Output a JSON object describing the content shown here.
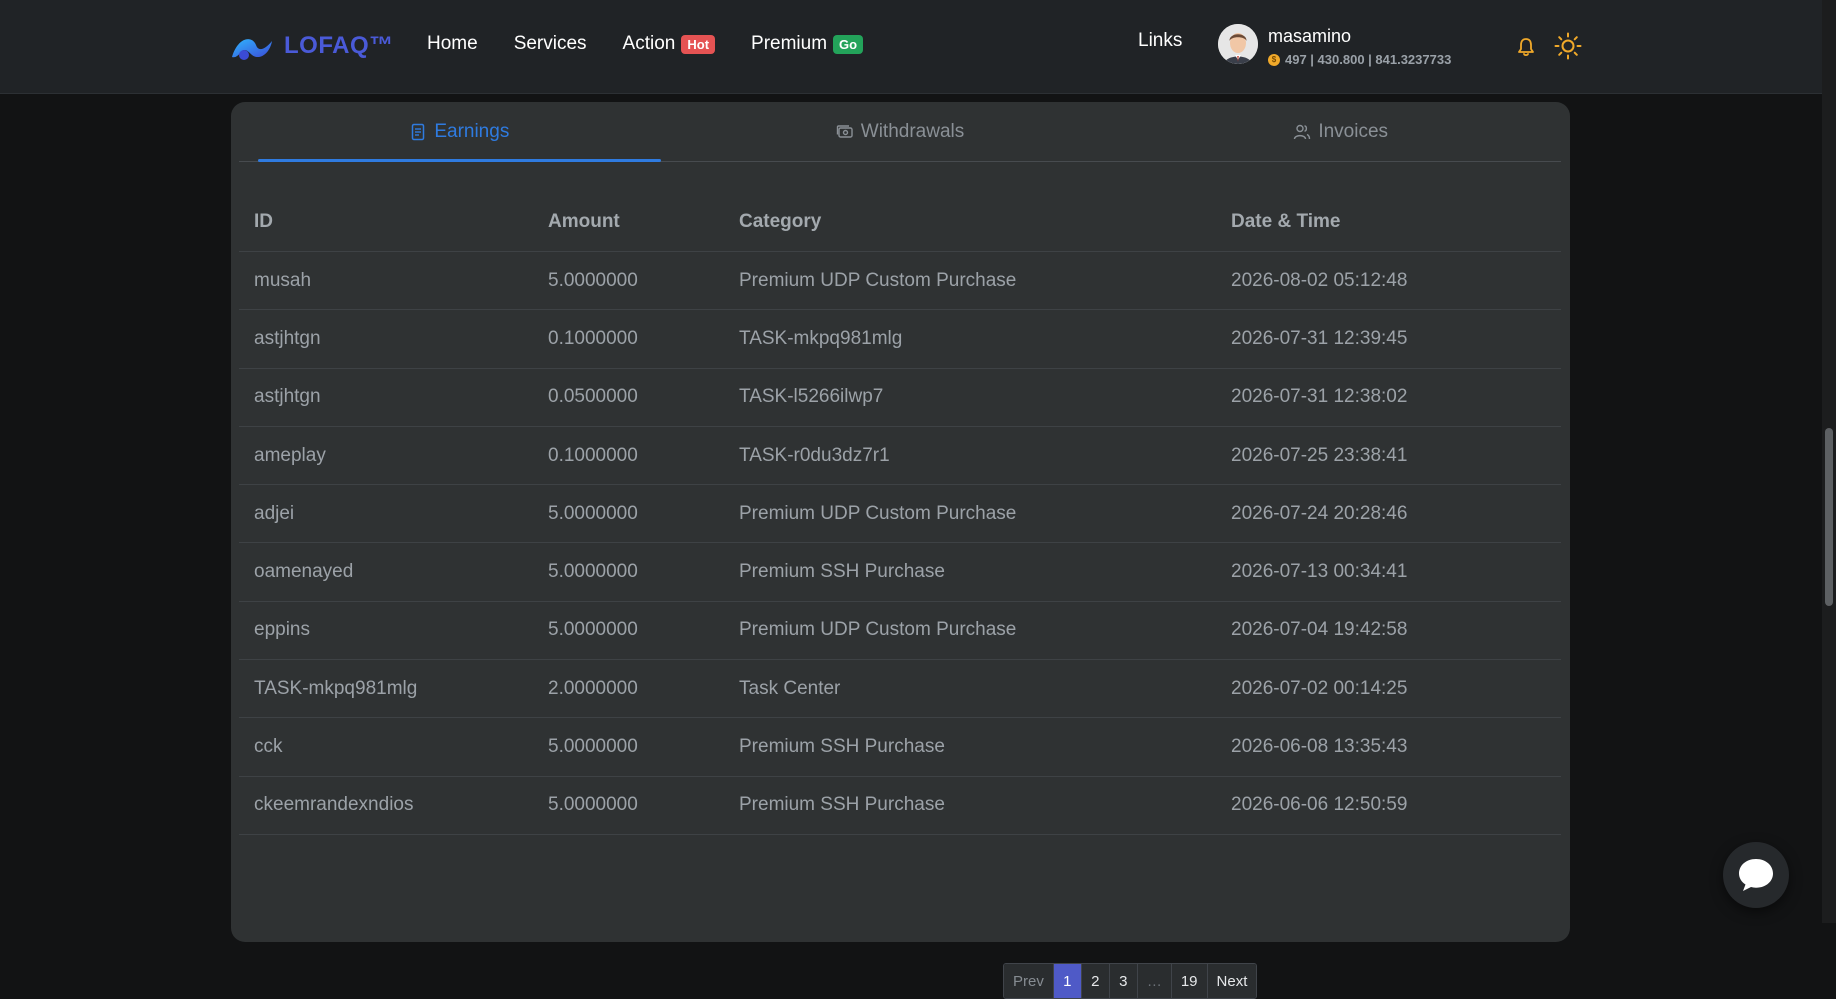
{
  "brand": {
    "name": "LOFAQ™",
    "icon": "wave-logo-icon"
  },
  "nav": {
    "items": [
      {
        "label": "Home"
      },
      {
        "label": "Services"
      },
      {
        "label": "Action",
        "badge": "Hot",
        "badge_color": "#e55353"
      },
      {
        "label": "Premium",
        "badge": "Go",
        "badge_color": "#23a35a"
      }
    ],
    "links_label": "Links"
  },
  "user": {
    "name": "masamino",
    "stats": "497 | 430.800 | 841.3237733"
  },
  "icons": {
    "notifications": "bell-icon",
    "theme": "sun-icon",
    "chat": "chat-bubble-icon"
  },
  "tabs": [
    {
      "label": "Earnings",
      "icon": "document-icon",
      "active": true
    },
    {
      "label": "Withdrawals",
      "icon": "money-icon",
      "active": false
    },
    {
      "label": "Invoices",
      "icon": "users-icon",
      "active": false
    }
  ],
  "table": {
    "headers": [
      "ID",
      "Amount",
      "Category",
      "Date & Time"
    ],
    "rows": [
      [
        "musah",
        "5.0000000",
        "Premium UDP Custom Purchase",
        "2026-08-02 05:12:48"
      ],
      [
        "astjhtgn",
        "0.1000000",
        "TASK-mkpq981mlg",
        "2026-07-31 12:39:45"
      ],
      [
        "astjhtgn",
        "0.0500000",
        "TASK-l5266ilwp7",
        "2026-07-31 12:38:02"
      ],
      [
        "ameplay",
        "0.1000000",
        "TASK-r0du3dz7r1",
        "2026-07-25 23:38:41"
      ],
      [
        "adjei",
        "5.0000000",
        "Premium UDP Custom Purchase",
        "2026-07-24 20:28:46"
      ],
      [
        "oamenayed",
        "5.0000000",
        "Premium SSH Purchase",
        "2026-07-13 00:34:41"
      ],
      [
        "eppins",
        "5.0000000",
        "Premium UDP Custom Purchase",
        "2026-07-04 19:42:58"
      ],
      [
        "TASK-mkpq981mlg",
        "2.0000000",
        "Task Center",
        "2026-07-02 00:14:25"
      ],
      [
        "cck",
        "5.0000000",
        "Premium SSH Purchase",
        "2026-06-08 13:35:43"
      ],
      [
        "ckeemrandexndios",
        "5.0000000",
        "Premium SSH Purchase",
        "2026-06-06 12:50:59"
      ]
    ]
  },
  "pagination": {
    "prev": "Prev",
    "pages": [
      "1",
      "2",
      "3",
      "…",
      "19"
    ],
    "current": "1",
    "next": "Next"
  },
  "colors": {
    "accent": "#2f7be0",
    "brand": "#4a5ad8",
    "page_active": "#4f5ac7",
    "background": "#121314",
    "card": "#2f3233"
  }
}
